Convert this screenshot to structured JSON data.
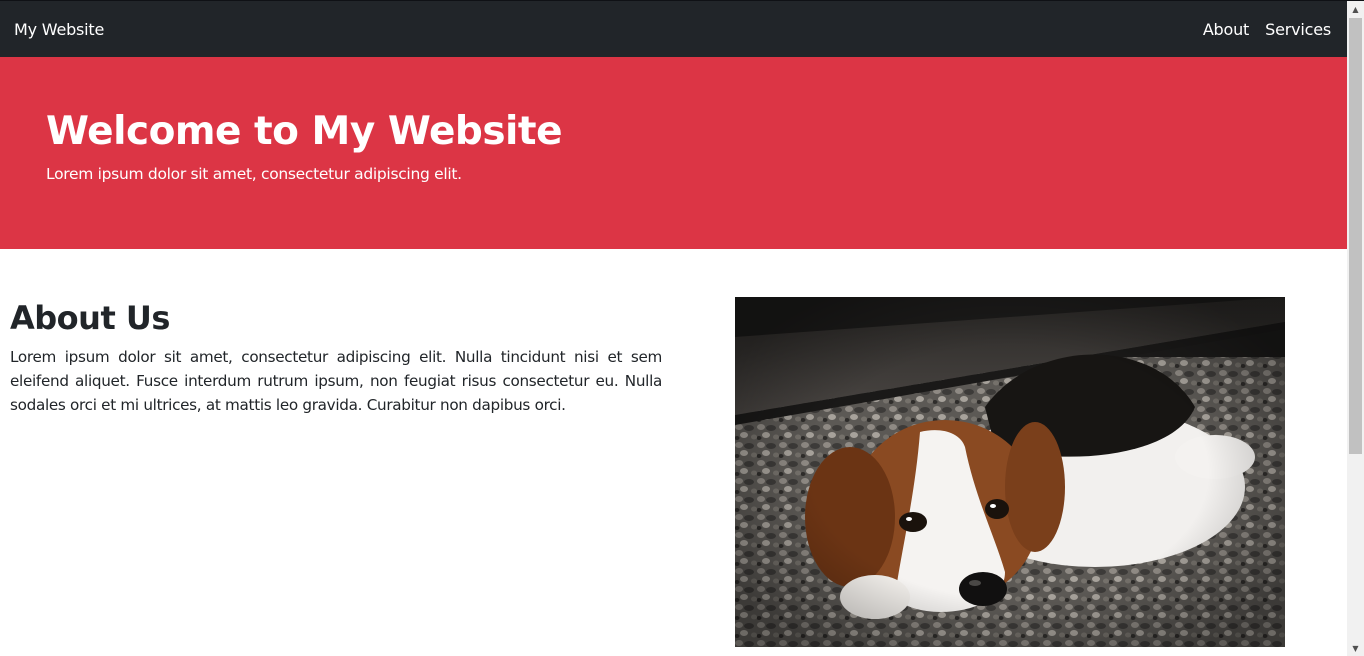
{
  "navbar": {
    "brand": "My Website",
    "links": [
      "About",
      "Services"
    ]
  },
  "hero": {
    "title": "Welcome to My Website",
    "subtitle": "Lorem ipsum dolor sit amet, consectetur adipiscing elit."
  },
  "about": {
    "heading": "About Us",
    "body": "Lorem ipsum dolor sit amet, consectetur adipiscing elit. Nulla tincidunt nisi et sem eleifend aliquet. Fusce interdum rutrum ipsum, non feugiat risus consectetur eu. Nulla sodales orci et mi ultrices, at mattis leo gravida. Curabitur non dapibus orci.",
    "image_subject": "beagle puppy lying on gravel"
  },
  "colors": {
    "navbar_bg": "#212529",
    "hero_bg": "#dc3545",
    "text": "#212529"
  },
  "icons": {
    "scroll_up": "scroll-up-arrow-icon",
    "scroll_down": "scroll-down-arrow-icon"
  }
}
